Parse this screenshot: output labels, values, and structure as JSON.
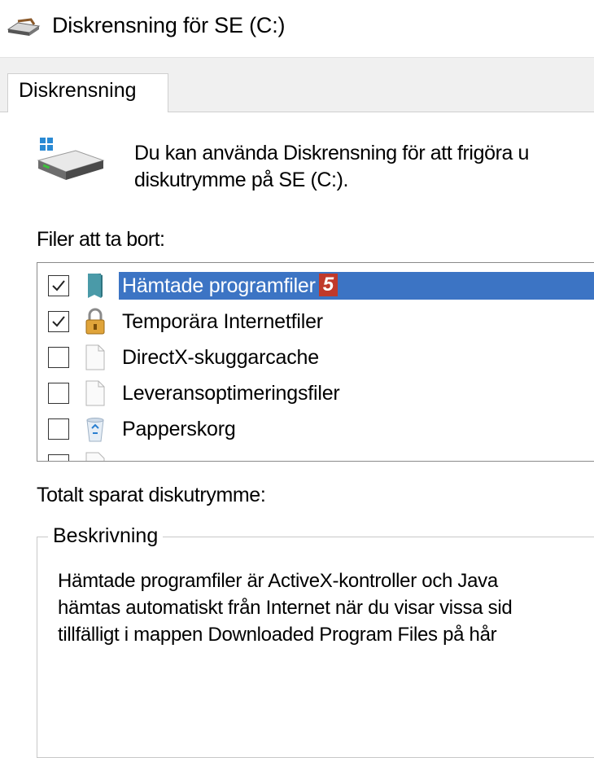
{
  "window": {
    "title": "Diskrensning för SE (C:)",
    "icon": "disk-cleanup-icon"
  },
  "tabs": [
    {
      "label": "Diskrensning",
      "active": true
    }
  ],
  "intro_text": "Du kan använda Diskrensning för att frigöra u\ndiskutrymme på SE (C:).",
  "files_label": "Filer att ta bort:",
  "files": [
    {
      "label": "Hämtade programfiler",
      "checked": true,
      "icon": "folder-icon",
      "selected": true,
      "badge": "5"
    },
    {
      "label": "Temporära Internetfiler",
      "checked": true,
      "icon": "lock-icon"
    },
    {
      "label": "DirectX-skuggarcache",
      "checked": false,
      "icon": "file-icon"
    },
    {
      "label": "Leveransoptimeringsfiler",
      "checked": false,
      "icon": "file-icon"
    },
    {
      "label": "Papperskorg",
      "checked": false,
      "icon": "recycle-bin-icon"
    }
  ],
  "total_label": "Totalt sparat diskutrymme:",
  "description": {
    "title": "Beskrivning",
    "text": "Hämtade programfiler är ActiveX-kontroller och Java\nhämtas automatiskt från Internet när du visar vissa sid\ntillfälligt i mappen Downloaded Program Files på hår"
  },
  "colors": {
    "selection": "#3c74c4",
    "badge": "#c0392b",
    "tabstrip": "#f0f0f0"
  }
}
